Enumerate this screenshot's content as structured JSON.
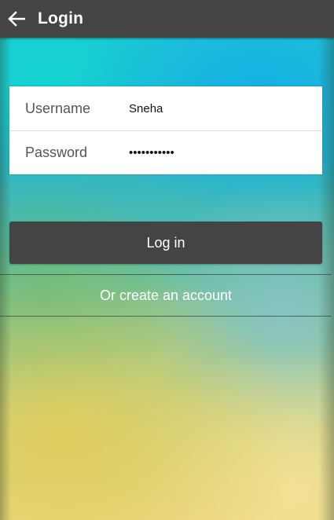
{
  "appbar": {
    "title": "Login",
    "back_icon": "arrow-left-icon",
    "background": "#444444"
  },
  "form": {
    "username": {
      "label": "Username",
      "value": "Sneha"
    },
    "password": {
      "label": "Password",
      "value": "•••••••••••"
    }
  },
  "actions": {
    "login_label": "Log in",
    "create_account_label": "Or create an account"
  },
  "colors": {
    "button": "#444444",
    "card": "#ffffff",
    "text_on_dark": "#ffffff"
  }
}
